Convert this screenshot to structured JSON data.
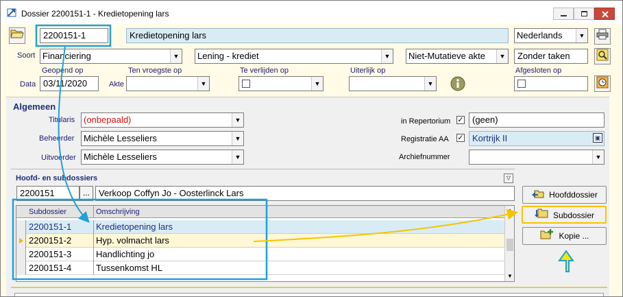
{
  "window": {
    "title": "Dossier 2200151-1 - Kredietopening  lars",
    "app_icon": "folder-arrow-icon",
    "controls": [
      "minimize-icon",
      "maximize-icon",
      "close-icon"
    ]
  },
  "header": {
    "dossier_number": "2200151-1",
    "dossier_name": "Kredietopening  lars",
    "language": "Nederlands",
    "task": "Zonder taken"
  },
  "row_soort": {
    "label": "Soort",
    "type": "Financiering",
    "subtype": "Lening - krediet",
    "act_type": "Niet-Mutatieve akte"
  },
  "dates": {
    "data_label": "Data",
    "akte_label": "Akte",
    "geopend_op_label": "Geopend op",
    "geopend_op_value": "03/11/2020",
    "ten_vroegste_label": "Ten vroegste op",
    "te_verlijden_label": "Te verlijden op",
    "uiterlijk_label": "Uiterlijk op",
    "afgesloten_label": "Afgesloten op"
  },
  "algemeen": {
    "title": "Algemeen",
    "titularis_label": "Titularis",
    "titularis_value": "(onbepaald)",
    "beheerder_label": "Beheerder",
    "beheerder_value": "Michèle Lesseliers",
    "uitvoerder_label": "Uitvoerder",
    "uitvoerder_value": "Michèle Lesseliers",
    "repertorium_label": "in Repertorium",
    "repertorium_value": "(geen)",
    "registratie_label": "Registratie AA",
    "registratie_value": "Kortrijk II",
    "archief_label": "Archiefnummer"
  },
  "subdossiers": {
    "title": "Hoofd- en subdossiers",
    "main_number": "2200151",
    "ellipsis": "...",
    "main_description": "Verkoop Coffyn Jo - Oosterlinck Lars",
    "columns": [
      "Subdossier",
      "Omschrijving"
    ],
    "rows": [
      {
        "number": "2200151-1",
        "description": "Kredietopening  lars",
        "selected": true
      },
      {
        "number": "2200151-2",
        "description": "Hyp. volmacht  lars",
        "current": true
      },
      {
        "number": "2200151-3",
        "description": "Handlichting  jo"
      },
      {
        "number": "2200151-4",
        "description": "Tussenkomst HL"
      }
    ]
  },
  "buttons": {
    "hoofddossier": "Hoofddossier",
    "subdossier": "Subdossier",
    "kopie": "Kopie ..."
  },
  "colors": {
    "highlight_blue": "#1fa0d8",
    "highlight_yellow": "#f5c400",
    "selected_row": "#d9ecf6",
    "current_row": "#fff7d6"
  }
}
